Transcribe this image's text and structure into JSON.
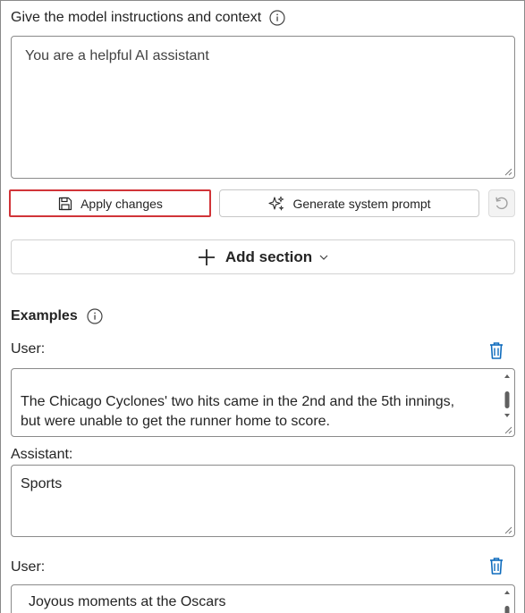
{
  "instructions": {
    "title": "Give the model instructions and context",
    "value": "You are a helpful AI assistant"
  },
  "buttons": {
    "apply": "Apply changes",
    "generate": "Generate system prompt",
    "add_section": "Add section"
  },
  "examples": {
    "title": "Examples",
    "items": [
      {
        "user_label": "User:",
        "user_lines": [
          "The Chicago Cyclones' two hits came in the 2nd and the 5th innings,",
          "but were unable to get the runner home to score."
        ],
        "assistant_label": "Assistant:",
        "assistant_value": "Sports"
      },
      {
        "user_label": "User:",
        "user_lines": [
          "Joyous moments at the Oscars"
        ]
      }
    ]
  },
  "colors": {
    "accent_blue": "#0f6cbd",
    "focus_red": "#d13438",
    "border": "#8a8a8a"
  },
  "icons": {
    "info": "info-icon",
    "save": "save-icon",
    "sparkle": "sparkle-icon",
    "undo": "undo-icon",
    "add": "plus-icon",
    "chevron": "chevron-down-icon",
    "delete": "trash-icon"
  }
}
